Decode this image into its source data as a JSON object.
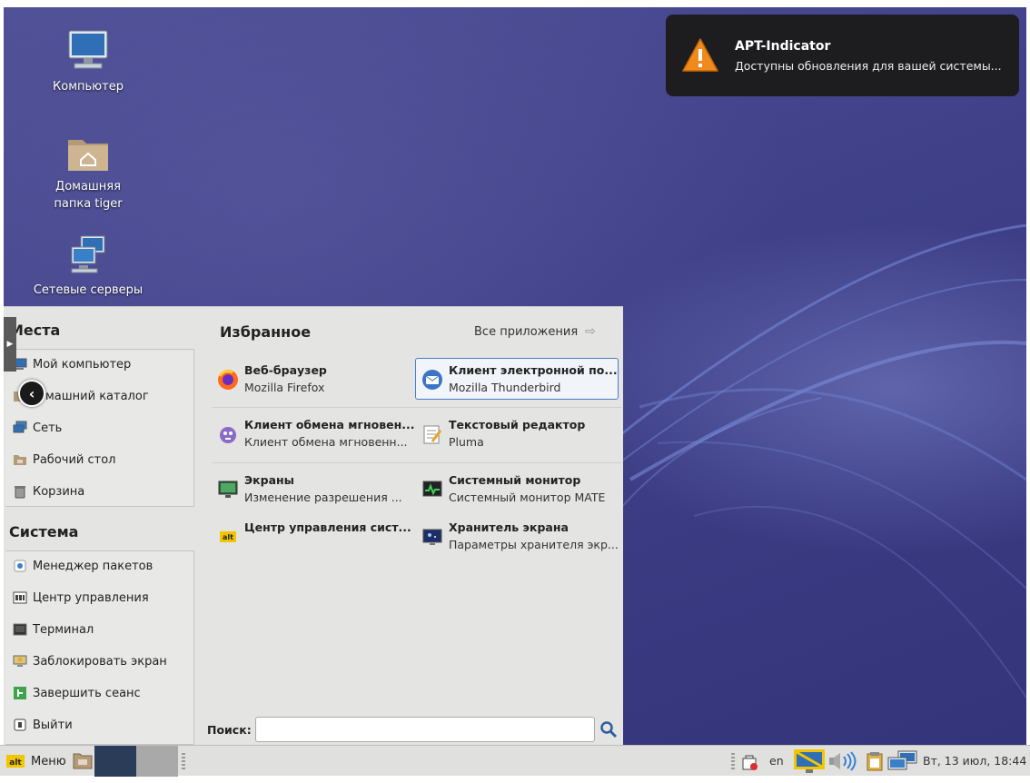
{
  "desktop": {
    "icons": [
      {
        "label": "Компьютер"
      },
      {
        "label": "Домашняя папка tiger"
      },
      {
        "label": "Сетевые серверы"
      }
    ]
  },
  "notification": {
    "title": "APT-Indicator",
    "body": "Доступны обновления для вашей системы..."
  },
  "menu": {
    "places_title": "Места",
    "places": [
      {
        "label": "Мой компьютер",
        "icon": "computer-icon"
      },
      {
        "label": "Домашний каталог",
        "icon": "home-folder-icon"
      },
      {
        "label": "Сеть",
        "icon": "network-icon"
      },
      {
        "label": "Рабочий стол",
        "icon": "desktop-folder-icon"
      },
      {
        "label": "Корзина",
        "icon": "trash-icon"
      }
    ],
    "places_visible_labels": [
      "Мой компьютер",
      "машний каталог",
      "Сеть",
      "Рабочий стол",
      "Корзина"
    ],
    "system_title": "Система",
    "system": [
      {
        "label": "Менеджер пакетов",
        "icon": "package-manager-icon"
      },
      {
        "label": "Центр управления",
        "icon": "control-center-icon"
      },
      {
        "label": "Терминал",
        "icon": "terminal-icon"
      },
      {
        "label": "Заблокировать экран",
        "icon": "lock-screen-icon"
      },
      {
        "label": "Завершить сеанс",
        "icon": "logout-icon"
      },
      {
        "label": "Выйти",
        "icon": "quit-icon"
      }
    ],
    "favorites_title": "Избранное",
    "all_apps_label": "Все приложения",
    "favorites": [
      {
        "name": "Веб-браузер",
        "desc": "Mozilla Firefox",
        "icon": "firefox-icon"
      },
      {
        "name": "Клиент электронной по...",
        "desc": "Mozilla Thunderbird",
        "icon": "thunderbird-icon",
        "selected": true
      },
      {
        "name": "Клиент обмена мгновен...",
        "desc": "Клиент обмена мгновенн...",
        "icon": "pidgin-icon"
      },
      {
        "name": "Текстовый редактор",
        "desc": "Pluma",
        "icon": "text-editor-icon"
      },
      {
        "name": "Экраны",
        "desc": "Изменение разрешения ...",
        "icon": "display-icon"
      },
      {
        "name": "Системный монитор",
        "desc": "Системный монитор MATE",
        "icon": "system-monitor-icon"
      },
      {
        "name": "Центр управления сист...",
        "desc": "",
        "icon": "alt-control-center-icon"
      },
      {
        "name": "Хранитель экрана",
        "desc": "Параметры хранителя экр...",
        "icon": "screensaver-icon"
      }
    ],
    "search_label": "Поиск:",
    "search_value": "",
    "search_placeholder": ""
  },
  "taskbar": {
    "menu_label": "Меню",
    "lang": "en",
    "clock": "Вт, 13 июл, 18:44"
  },
  "colors": {
    "desktop_bg": "#3f4088",
    "menu_bg": "#e4e4e3",
    "notify_bg": "#1d1d1f",
    "selection_border": "#4a7dc4"
  }
}
